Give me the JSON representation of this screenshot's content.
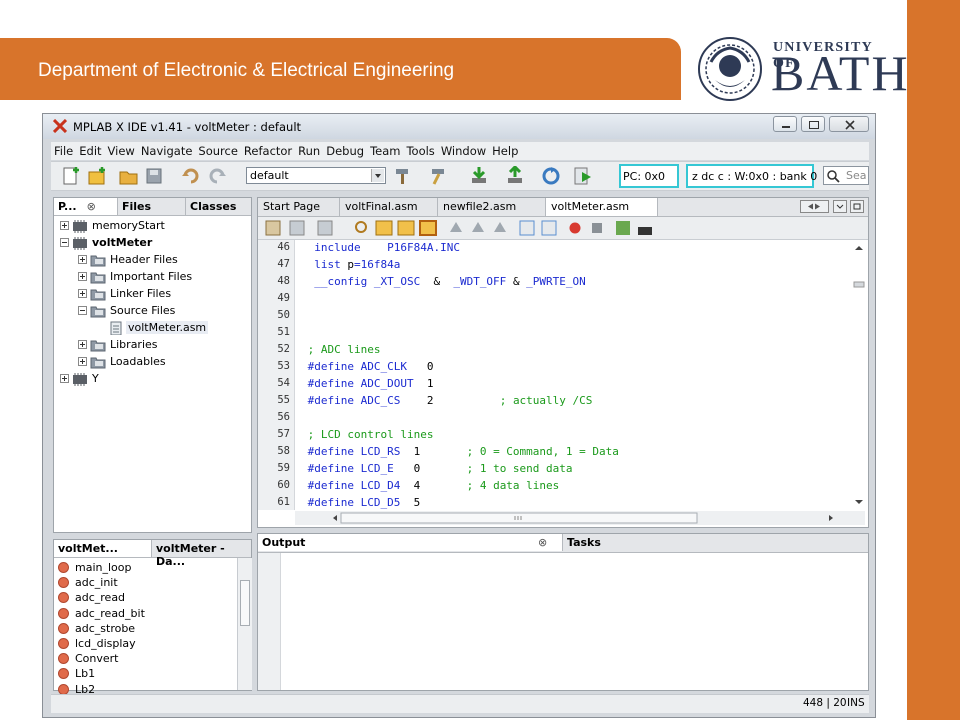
{
  "slide": {
    "banner_title": "Department of Electronic & Electrical Engineering",
    "logo_univ": "UNIVERSITY OF",
    "logo_bath": "BATH",
    "accent_color": "#d8742b"
  },
  "window": {
    "title": "MPLAB X IDE v1.41 - voltMeter : default"
  },
  "menu": [
    "File",
    "Edit",
    "View",
    "Navigate",
    "Source",
    "Refactor",
    "Run",
    "Debug",
    "Team",
    "Tools",
    "Window",
    "Help"
  ],
  "toolbar": {
    "config_value": "default",
    "pc_value": "PC: 0x0",
    "status_value": "z dc c  : W:0x0 : bank 0",
    "search_placeholder": "Sea"
  },
  "projects_panel": {
    "tabs": [
      "P...",
      "Files",
      "Classes"
    ],
    "tree": [
      {
        "label": "memoryStart",
        "level": 0,
        "icon": "chip-icon",
        "expander": "plus"
      },
      {
        "label": "voltMeter",
        "level": 0,
        "icon": "chip-icon",
        "expander": "minus",
        "bold": true
      },
      {
        "label": "Header Files",
        "level": 1,
        "icon": "folder-icon",
        "expander": "plus"
      },
      {
        "label": "Important Files",
        "level": 1,
        "icon": "folder-icon",
        "expander": "plus"
      },
      {
        "label": "Linker Files",
        "level": 1,
        "icon": "folder-icon",
        "expander": "plus"
      },
      {
        "label": "Source Files",
        "level": 1,
        "icon": "folder-icon",
        "expander": "minus"
      },
      {
        "label": "voltMeter.asm",
        "level": 2,
        "icon": "file-icon",
        "expander": "none",
        "selected": true
      },
      {
        "label": "Libraries",
        "level": 1,
        "icon": "folder-icon",
        "expander": "plus"
      },
      {
        "label": "Loadables",
        "level": 1,
        "icon": "folder-icon",
        "expander": "plus"
      },
      {
        "label": "Y",
        "level": 0,
        "icon": "chip-icon",
        "expander": "plus"
      }
    ]
  },
  "navigator_panel": {
    "tabs": [
      "voltMet...",
      "voltMeter - Da..."
    ],
    "items": [
      "main_loop",
      "adc_init",
      "adc_read",
      "adc_read_bit",
      "adc_strobe",
      "lcd_display",
      "Convert",
      "Lb1",
      "Lb2"
    ]
  },
  "editor": {
    "tabs": [
      "Start Page",
      "voltFinal.asm",
      "newfile2.asm",
      "voltMeter.asm"
    ],
    "active_tab": 3,
    "lines": [
      {
        "n": "46",
        "parts": [
          [
            "kw",
            "  include    P16F84A.INC"
          ]
        ]
      },
      {
        "n": "47",
        "parts": [
          [
            "kw",
            "  list "
          ],
          [
            "cn",
            "p"
          ],
          [
            "kw",
            "=16f84a"
          ]
        ]
      },
      {
        "n": "48",
        "parts": [
          [
            "kw",
            "  __config _XT_OSC  "
          ],
          [
            "cn",
            "&"
          ],
          [
            "kw",
            "  _WDT_OFF "
          ],
          [
            "cn",
            "&"
          ],
          [
            "kw",
            " _PWRTE_ON"
          ]
        ]
      },
      {
        "n": "49",
        "parts": []
      },
      {
        "n": "50",
        "parts": []
      },
      {
        "n": "51",
        "parts": []
      },
      {
        "n": "52",
        "parts": [
          [
            "cm",
            " ; ADC lines"
          ]
        ]
      },
      {
        "n": "53",
        "parts": [
          [
            "kw",
            " #define ADC_CLK   "
          ],
          [
            "cn",
            "0"
          ]
        ]
      },
      {
        "n": "54",
        "parts": [
          [
            "kw",
            " #define ADC_DOUT  "
          ],
          [
            "cn",
            "1"
          ]
        ]
      },
      {
        "n": "55",
        "parts": [
          [
            "kw",
            " #define ADC_CS    "
          ],
          [
            "cn",
            "2"
          ],
          [
            "cm",
            "          ; actually /CS"
          ]
        ]
      },
      {
        "n": "56",
        "parts": []
      },
      {
        "n": "57",
        "parts": [
          [
            "cm",
            " ; LCD control lines"
          ]
        ]
      },
      {
        "n": "58",
        "parts": [
          [
            "kw",
            " #define LCD_RS  "
          ],
          [
            "cn",
            "1"
          ],
          [
            "cm",
            "       ; 0 = Command, 1 = Data"
          ]
        ]
      },
      {
        "n": "59",
        "parts": [
          [
            "kw",
            " #define LCD_E   "
          ],
          [
            "cn",
            "0"
          ],
          [
            "cm",
            "       ; 1 to send data"
          ]
        ]
      },
      {
        "n": "60",
        "parts": [
          [
            "kw",
            " #define LCD_D4  "
          ],
          [
            "cn",
            "4"
          ],
          [
            "cm",
            "       ; 4 data lines"
          ]
        ]
      },
      {
        "n": "61",
        "parts": [
          [
            "kw",
            " #define LCD_D5  "
          ],
          [
            "cn",
            "5"
          ]
        ]
      }
    ]
  },
  "output_panel": {
    "tabs": [
      "Output",
      "Tasks"
    ]
  },
  "statusbar": {
    "position": "448 | 20",
    "mode": "INS"
  }
}
